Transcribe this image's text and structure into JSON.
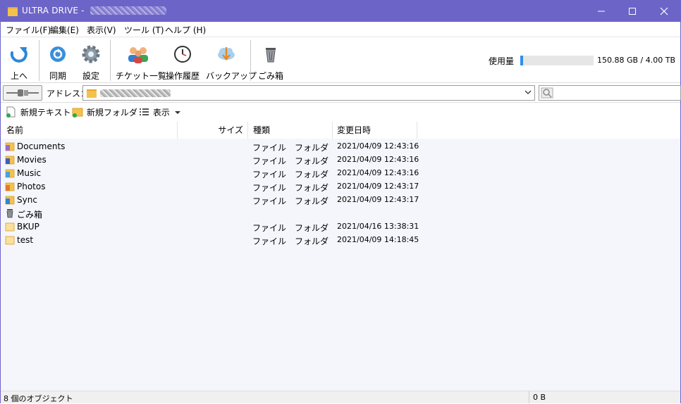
{
  "window": {
    "title": "ULTRA DRIVE - "
  },
  "menu": [
    {
      "label": "ファイル(F)"
    },
    {
      "label": "編集(E)"
    },
    {
      "label": "表示(V)"
    },
    {
      "label": "ツール (T)"
    },
    {
      "label": "ヘルプ (H)"
    }
  ],
  "toolbar": {
    "up": "上へ",
    "sync": "同期",
    "settings": "設定",
    "tickets": "チケット一覧",
    "history": "操作履歴",
    "backup": "バックアップ",
    "trash": "ごみ箱"
  },
  "usage": {
    "label": "使用量",
    "text": "150.88 GB / 4.00 TB",
    "fraction": 0.0368
  },
  "address": {
    "label": "アドレス："
  },
  "actions": {
    "new_text": "新規テキスト",
    "new_folder": "新規フォルダ",
    "view": "表示"
  },
  "columns": {
    "name": "名前",
    "size": "サイズ",
    "type": "種類",
    "modified": "変更日時"
  },
  "files": [
    {
      "name": "Documents",
      "type": "ファイル　フォルダ",
      "modified": "2021/04/09 12:43:16",
      "icon": "documents-folder-icon"
    },
    {
      "name": "Movies",
      "type": "ファイル　フォルダ",
      "modified": "2021/04/09 12:43:16",
      "icon": "movies-folder-icon"
    },
    {
      "name": "Music",
      "type": "ファイル　フォルダ",
      "modified": "2021/04/09 12:43:16",
      "icon": "music-folder-icon"
    },
    {
      "name": "Photos",
      "type": "ファイル　フォルダ",
      "modified": "2021/04/09 12:43:17",
      "icon": "photos-folder-icon"
    },
    {
      "name": "Sync",
      "type": "ファイル　フォルダ",
      "modified": "2021/04/09 12:43:17",
      "icon": "sync-folder-icon"
    },
    {
      "name": "ごみ箱",
      "type": "",
      "modified": "",
      "icon": "trash-icon"
    },
    {
      "name": "BKUP",
      "type": "ファイル　フォルダ",
      "modified": "2021/04/16 13:38:31",
      "icon": "folder-icon"
    },
    {
      "name": "test",
      "type": "ファイル　フォルダ",
      "modified": "2021/04/09 14:18:45",
      "icon": "folder-icon"
    }
  ],
  "status": {
    "count": "8 個のオブジェクト",
    "size": "0 B"
  }
}
